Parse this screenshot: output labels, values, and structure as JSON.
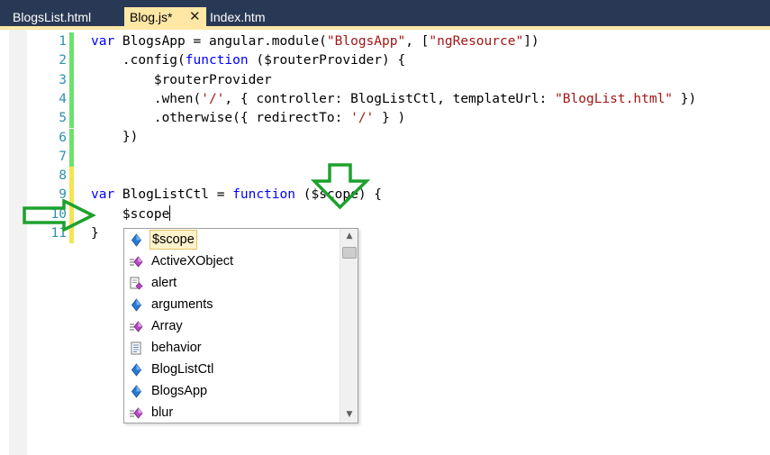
{
  "tabs": [
    {
      "label": "BlogsList.html"
    },
    {
      "label": "Blog.js*",
      "active": true
    },
    {
      "label": "Index.htm"
    }
  ],
  "tab_close_icon": "close-icon",
  "line_numbers": [
    "1",
    "2",
    "3",
    "4",
    "5",
    "6",
    "7",
    "8",
    "9",
    "10",
    "11"
  ],
  "code_lines": [
    [
      {
        "t": "var",
        "c": "kw"
      },
      {
        "t": " BlogsApp = angular.module("
      },
      {
        "t": "\"BlogsApp\"",
        "c": "str"
      },
      {
        "t": ", ["
      },
      {
        "t": "\"ngResource\"",
        "c": "str"
      },
      {
        "t": "])"
      }
    ],
    [
      {
        "t": "    .config("
      },
      {
        "t": "function",
        "c": "kw"
      },
      {
        "t": " ($routerProvider) {"
      }
    ],
    [
      {
        "t": "        $routerProvider"
      }
    ],
    [
      {
        "t": "        .when("
      },
      {
        "t": "'/'",
        "c": "str"
      },
      {
        "t": ", { controller: BlogListCtl, templateUrl: "
      },
      {
        "t": "\"BlogList.html\"",
        "c": "str"
      },
      {
        "t": " })"
      }
    ],
    [
      {
        "t": "        .otherwise({ redirectTo: "
      },
      {
        "t": "'/'",
        "c": "str"
      },
      {
        "t": " } )"
      }
    ],
    [
      {
        "t": "    })"
      }
    ],
    [],
    [],
    [
      {
        "t": "var",
        "c": "kw"
      },
      {
        "t": " BlogListCtl = "
      },
      {
        "t": "function",
        "c": "kw"
      },
      {
        "t": " ($scope) {"
      }
    ],
    [
      {
        "t": "    $scope"
      },
      {
        "caret": true
      }
    ],
    [
      {
        "t": "}"
      }
    ]
  ],
  "change_marks": [
    "saved",
    "saved",
    "saved",
    "saved",
    "saved",
    "saved",
    "saved",
    "unsaved",
    "unsaved",
    "unsaved",
    "unsaved"
  ],
  "intellisense": {
    "items": [
      {
        "label": "$scope",
        "icon": "variable-icon",
        "selected": true
      },
      {
        "label": "ActiveXObject",
        "icon": "method-icon"
      },
      {
        "label": "alert",
        "icon": "function-icon"
      },
      {
        "label": "arguments",
        "icon": "variable-icon"
      },
      {
        "label": "Array",
        "icon": "method-icon"
      },
      {
        "label": "behavior",
        "icon": "property-icon"
      },
      {
        "label": "BlogListCtl",
        "icon": "variable-icon"
      },
      {
        "label": "BlogsApp",
        "icon": "variable-icon"
      },
      {
        "label": "blur",
        "icon": "method-icon"
      }
    ],
    "scroll_up_icon": "scroll-up-icon",
    "scroll_down_icon": "scroll-down-icon"
  },
  "annotations": [
    "down-arrow-icon",
    "right-arrow-icon"
  ],
  "colors": {
    "tab_bar": "#293955",
    "active_tab": "#FFE8A6",
    "keyword": "#0000FF",
    "string": "#A31515",
    "line_number": "#2B91AF",
    "saved_change": "#6CE26C",
    "unsaved_change": "#F4E451",
    "annotation_arrow": "#1DA12E"
  }
}
